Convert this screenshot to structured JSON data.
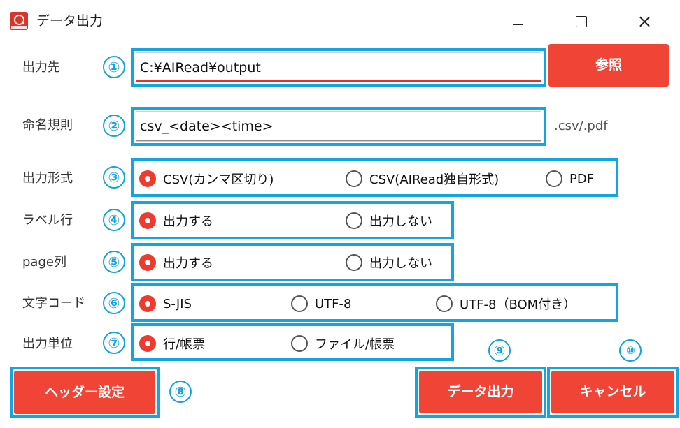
{
  "window": {
    "title": "データ出力",
    "icon": "app-logo-icon"
  },
  "colors": {
    "accent_red": "#f04436",
    "highlight_blue": "#13a5e0"
  },
  "fields": {
    "output_dir": {
      "label": "出力先",
      "value": "C:¥AIRead¥output",
      "browse_label": "参照"
    },
    "naming_rule": {
      "label": "命名規則",
      "value": "csv_<date><time>",
      "suffix": ".csv/.pdf"
    }
  },
  "options": {
    "format": {
      "label": "出力形式",
      "choices": [
        "CSV(カンマ区切り)",
        "CSV(AIRead独自形式)",
        "PDF"
      ],
      "selected": 0
    },
    "label_row": {
      "label": "ラベル行",
      "choices": [
        "出力する",
        "出力しない"
      ],
      "selected": 0
    },
    "page_col": {
      "label": "page列",
      "choices": [
        "出力する",
        "出力しない"
      ],
      "selected": 0
    },
    "encoding": {
      "label": "文字コード",
      "choices": [
        "S-JIS",
        "UTF-8",
        "UTF-8（BOM付き）"
      ],
      "selected": 0
    },
    "unit": {
      "label": "出力単位",
      "choices": [
        "行/帳票",
        "ファイル/帳票"
      ],
      "selected": 0
    }
  },
  "buttons": {
    "header_settings": "ヘッダー設定",
    "export": "データ出力",
    "cancel": "キャンセル"
  },
  "markers": [
    "①",
    "②",
    "③",
    "④",
    "⑤",
    "⑥",
    "⑦",
    "⑧",
    "⑨",
    "⑩"
  ]
}
